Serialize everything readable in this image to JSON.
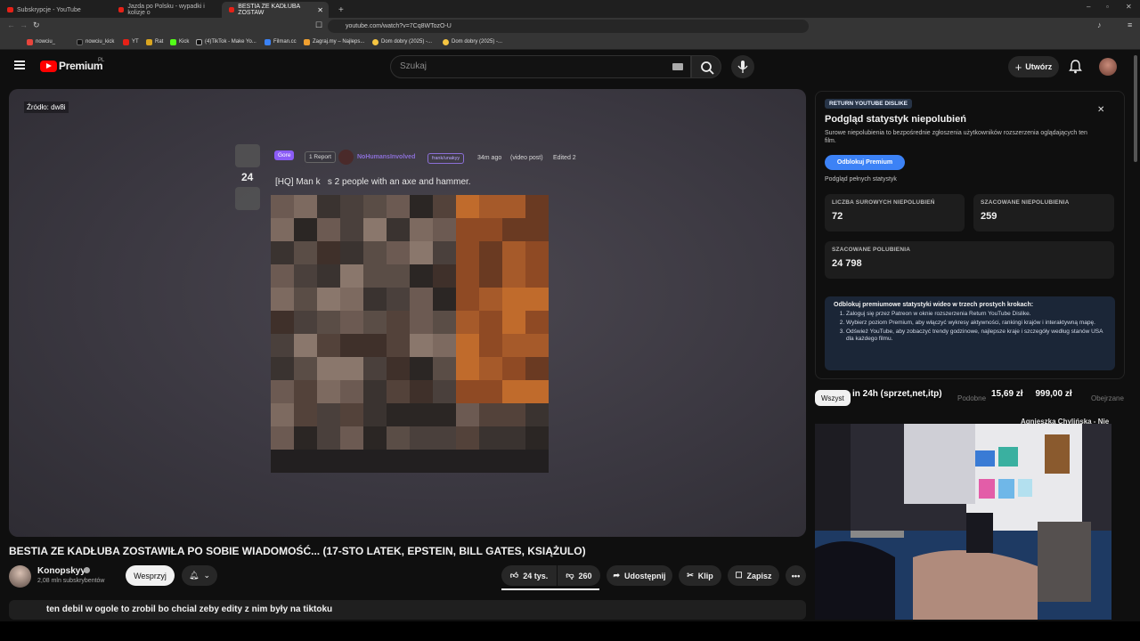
{
  "browser": {
    "tabs": [
      {
        "title": "Subskrypcje - YouTube"
      },
      {
        "title": "Jazda po Polsku - wypadki i kolizje o"
      },
      {
        "title": "BESTIA ZE KADŁUBA ZOSTAW"
      }
    ],
    "url": "youtube.com/watch?v=7Cq8WTozO-U",
    "bookmarks": [
      "nowciu_",
      "nowciu_kick",
      "YT",
      "Rat",
      "Kick",
      "(4)TikTok - Make Yo...",
      "Filman.cc",
      "Zagraj.my – Najleps...",
      "Dom dobry (2025) -...",
      "Dom dobry (2025) -..."
    ]
  },
  "header": {
    "logo_text": "Premium",
    "logo_region": "PL",
    "search_placeholder": "Szukaj",
    "create_label": "Utwórz"
  },
  "video": {
    "source_label": "Źródło: dw8i",
    "post": {
      "score": "24",
      "tag_gore": "Gore",
      "tag_report": "1 Report",
      "author": "NoHumansInvolved",
      "author_badge": "frank/unakyy",
      "time": "34m ago",
      "post_type": "(video post)",
      "edited": "Edited 2",
      "title": "[HQ] Man k   s 2 people with an axe and hammer."
    }
  },
  "below": {
    "title": "BESTIA ZE KADŁUBA ZOSTAWIŁA PO SOBIE WIADOMOŚĆ... (17-STO LATEK, EPSTEIN, BILL GATES, KSIĄŻULO)",
    "channel_name": "Konopskyy",
    "subs": "2,08 mln subskrybentów",
    "support_label": "Wesprzyj",
    "likes": "24 tys.",
    "dislikes": "260",
    "share_label": "Udostępnij",
    "clip_label": "Klip",
    "save_label": "Zapisz",
    "chat_message": "ten debil w ogole to zrobil bo chcial zeby edity z nim były na tiktoku"
  },
  "ryd": {
    "tag": "RETURN YOUTUBE DISLIKE",
    "title": "Podgląd statystyk niepolubień",
    "subtitle": "Surowe niepolubienia to bezpośrednie zgłoszenia użytkowników rozszerzenia oglądających ten film.",
    "unlock_label": "Odblokuj Premium",
    "preview_label": "Podgląd pełnych statystyk",
    "stats": [
      {
        "label": "LICZBA SUROWYCH NIEPOLUBIEŃ",
        "value": "72"
      },
      {
        "label": "SZACOWANE NIEPOLUBIENIA",
        "value": "259"
      },
      {
        "label": "SZACOWANE POLUBIENIA",
        "value": "24 798"
      }
    ],
    "steps_title": "Odblokuj premiumowe statystyki wideo w trzech prostych krokach:",
    "steps": [
      "Zaloguj się przez Patreon w oknie rozszerzenia Return YouTube Dislike.",
      "Wybierz poziom Premium, aby włączyć wykresy aktywności, rankingi krajów i interaktywną mapę.",
      "Odśwież YouTube, aby zobaczyć trendy godzinowe, najlepsze kraje i szczegóły według stanów USA dla każdego filmu."
    ]
  },
  "sidebar": {
    "chips": [
      "Wszyst",
      "Podobne",
      "Obejrzane"
    ],
    "overlay_text": "in 24h (sprzet,net,itp)",
    "overlay_price": "15,69 zł     999,00 zł",
    "mini_title": "Agnieszka Chylińska - Nie"
  },
  "colors": {
    "accent_blue": "#3c82f6",
    "yt_red": "#ff0000",
    "gore_purple": "#8b5cf6"
  }
}
